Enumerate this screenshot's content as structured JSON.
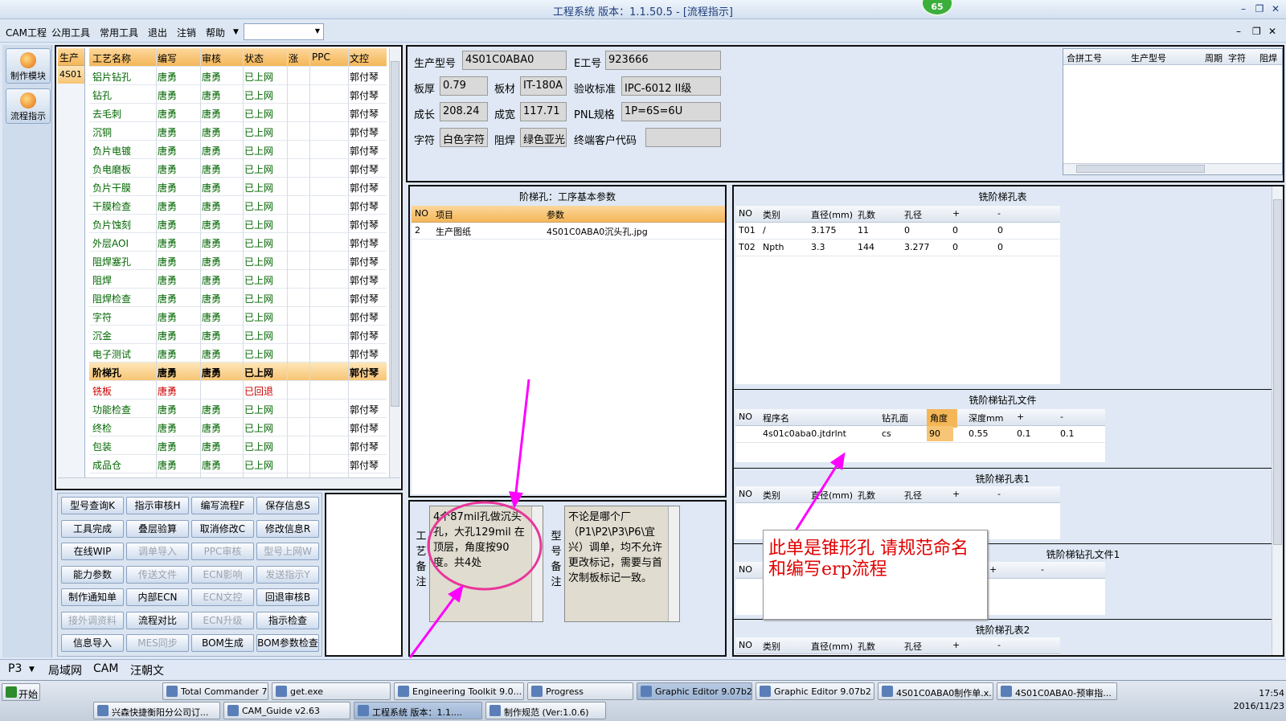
{
  "window": {
    "title": "工程系统  版本：1.1.50.5 - [流程指示]",
    "badge": "65"
  },
  "menu": [
    "CAM工程",
    "公用工具",
    "常用工具",
    "退出",
    "注销",
    "帮助"
  ],
  "left_toolbar": [
    "制作模块",
    "流程指示"
  ],
  "step_list": {
    "side_col_header": "生产",
    "side_col_value": "4S01",
    "headers": [
      "工艺名称",
      "编写",
      "审核",
      "状态",
      "涨",
      "PPC",
      "文控"
    ],
    "rows": [
      [
        "铝片钻孔",
        "唐勇",
        "唐勇",
        "已上网",
        "",
        "",
        "郭付琴"
      ],
      [
        "钻孔",
        "唐勇",
        "唐勇",
        "已上网",
        "",
        "",
        "郭付琴"
      ],
      [
        "去毛刺",
        "唐勇",
        "唐勇",
        "已上网",
        "",
        "",
        "郭付琴"
      ],
      [
        "沉铜",
        "唐勇",
        "唐勇",
        "已上网",
        "",
        "",
        "郭付琴"
      ],
      [
        "负片电镀",
        "唐勇",
        "唐勇",
        "已上网",
        "",
        "",
        "郭付琴"
      ],
      [
        "负电磨板",
        "唐勇",
        "唐勇",
        "已上网",
        "",
        "",
        "郭付琴"
      ],
      [
        "负片干膜",
        "唐勇",
        "唐勇",
        "已上网",
        "",
        "",
        "郭付琴"
      ],
      [
        "干膜检查",
        "唐勇",
        "唐勇",
        "已上网",
        "",
        "",
        "郭付琴"
      ],
      [
        "负片蚀刻",
        "唐勇",
        "唐勇",
        "已上网",
        "",
        "",
        "郭付琴"
      ],
      [
        "外层AOI",
        "唐勇",
        "唐勇",
        "已上网",
        "",
        "",
        "郭付琴"
      ],
      [
        "阻焊塞孔",
        "唐勇",
        "唐勇",
        "已上网",
        "",
        "",
        "郭付琴"
      ],
      [
        "阻焊",
        "唐勇",
        "唐勇",
        "已上网",
        "",
        "",
        "郭付琴"
      ],
      [
        "阻焊检查",
        "唐勇",
        "唐勇",
        "已上网",
        "",
        "",
        "郭付琴"
      ],
      [
        "字符",
        "唐勇",
        "唐勇",
        "已上网",
        "",
        "",
        "郭付琴"
      ],
      [
        "沉金",
        "唐勇",
        "唐勇",
        "已上网",
        "",
        "",
        "郭付琴"
      ],
      [
        "电子测试",
        "唐勇",
        "唐勇",
        "已上网",
        "",
        "",
        "郭付琴"
      ],
      [
        "阶梯孔",
        "唐勇",
        "唐勇",
        "已上网",
        "",
        "",
        "郭付琴"
      ],
      [
        "铣板",
        "唐勇",
        "",
        "已回退",
        "",
        "",
        ""
      ],
      [
        "功能检查",
        "唐勇",
        "唐勇",
        "已上网",
        "",
        "",
        "郭付琴"
      ],
      [
        "终检",
        "唐勇",
        "唐勇",
        "已上网",
        "",
        "",
        "郭付琴"
      ],
      [
        "包装",
        "唐勇",
        "唐勇",
        "已上网",
        "",
        "",
        "郭付琴"
      ],
      [
        "成品仓",
        "唐勇",
        "唐勇",
        "已上网",
        "",
        "",
        "郭付琴"
      ]
    ],
    "selected_index": 16,
    "returned_index": 17
  },
  "buttons": [
    [
      "型号查询K",
      "指示审核H",
      "编写流程F",
      "保存信息S"
    ],
    [
      "工具完成",
      "叠层验算",
      "取消修改C",
      "修改信息R"
    ],
    [
      "在线WIP",
      "调单导入",
      "PPC审核",
      "型号上网W"
    ],
    [
      "能力参数",
      "传送文件",
      "ECN影响",
      "发送指示Y"
    ],
    [
      "制作通知单",
      "内部ECN",
      "ECN文控",
      "回退审核B"
    ],
    [
      "接外调资料",
      "流程对比",
      "ECN升级",
      "指示检查"
    ],
    [
      "信息导入",
      "MES同步",
      "BOM生成",
      "BOM参数检查"
    ]
  ],
  "buttons_disabled": [
    [
      2,
      1
    ],
    [
      2,
      2
    ],
    [
      2,
      3
    ],
    [
      3,
      1
    ],
    [
      3,
      2
    ],
    [
      3,
      3
    ],
    [
      4,
      2
    ],
    [
      5,
      0
    ],
    [
      5,
      2
    ],
    [
      6,
      1
    ]
  ],
  "info": {
    "model_label": "生产型号",
    "model": "4S01C0ABA0",
    "eno_label": "E工号",
    "eno": "923666",
    "thick_label": "板厚",
    "thick": "0.79",
    "mat_label": "板材",
    "mat": "IT-180A",
    "std_label": "验收标准",
    "std": "IPC-6012 II级",
    "len_label": "成长",
    "len": "208.24",
    "wid_label": "成宽",
    "wid": "117.71",
    "pnl_label": "PNL规格",
    "pnl": "1P=6S=6U",
    "char_label": "字符",
    "char": "白色字符",
    "mask_label": "阻焊",
    "mask": "绿色亚光",
    "cust_label": "终端客户代码",
    "cust": ""
  },
  "merge_headers": [
    "合拼工号",
    "生产型号",
    "周期",
    "字符",
    "阻焊"
  ],
  "param_panel": {
    "title": "阶梯孔：工序基本参数",
    "headers": [
      "NO",
      "项目",
      "参数"
    ],
    "rows": [
      [
        "2",
        "生产图纸",
        "4S01C0ABA0沉头孔.jpg"
      ]
    ]
  },
  "memo": {
    "label1": [
      "工",
      "艺",
      "备",
      "注"
    ],
    "text1": "4个87mil孔做沉头孔，大孔129mil 在顶层，角度按90度。共4处",
    "label2": [
      "型",
      "号",
      "备",
      "注"
    ],
    "text2": "不论是哪个厂（P1\\P2\\P3\\P6\\宜兴）调单，均不允许更改标记，需要与首次制板标记一致。"
  },
  "right": {
    "t1": {
      "title": "铣阶梯孔表",
      "headers": [
        "NO",
        "类别",
        "直径(mm)",
        "孔数",
        "孔径",
        "+",
        "-"
      ],
      "rows": [
        [
          "T01",
          "/",
          "3.175",
          "11",
          "0",
          "0",
          "0"
        ],
        [
          "T02",
          "Npth",
          "3.3",
          "144",
          "3.277",
          "0",
          "0"
        ]
      ]
    },
    "t2": {
      "title": "铣阶梯钻孔文件",
      "headers": [
        "NO",
        "程序名",
        "钻孔面",
        "角度",
        "深度mm",
        "+",
        "-"
      ],
      "rows": [
        [
          "",
          "4s01c0aba0.jtdrlnt",
          "cs",
          "90",
          "0.55",
          "0.1",
          "0.1"
        ]
      ]
    },
    "t3": {
      "title": "铣阶梯孔表1",
      "headers": [
        "NO",
        "类别",
        "直径(mm)",
        "孔数",
        "孔径",
        "+",
        "-"
      ]
    },
    "t4": {
      "title": "铣阶梯钻孔文件1",
      "headers": [
        "NO",
        "",
        "",
        "",
        "",
        "+",
        "-"
      ]
    },
    "t5": {
      "title": "铣阶梯孔表2",
      "headers": [
        "NO",
        "类别",
        "直径(mm)",
        "孔数",
        "孔径",
        "+",
        "-"
      ]
    }
  },
  "note": "此单是锥形孔    请规范命名和编写erp流程",
  "status_tabs": [
    "P3",
    "局域网",
    "CAM",
    "汪朝文"
  ],
  "taskbar": {
    "start": "开始",
    "row1": [
      "Total Commander 7.0 ...",
      "get.exe",
      "Engineering Toolkit 9.0...",
      "Progress",
      "Graphic Editor 9.07b2 ...",
      "Graphic Editor 9.07b2 ...",
      "4S01C0ABA0制作单.x...",
      "4S01C0ABA0-预审指..."
    ],
    "row2": [
      "兴森快捷衡阳分公司订...",
      "CAM_Guide v2.63",
      "工程系统  版本：1.1....",
      "制作规范 (Ver:1.0.6)"
    ],
    "time": "17:54",
    "date": "2016/11/23"
  },
  "colors": {
    "accent_orange": "#f4b758",
    "text_green": "#006600",
    "text_red": "#cc0000",
    "annotation_magenta": "#ff00ff"
  }
}
